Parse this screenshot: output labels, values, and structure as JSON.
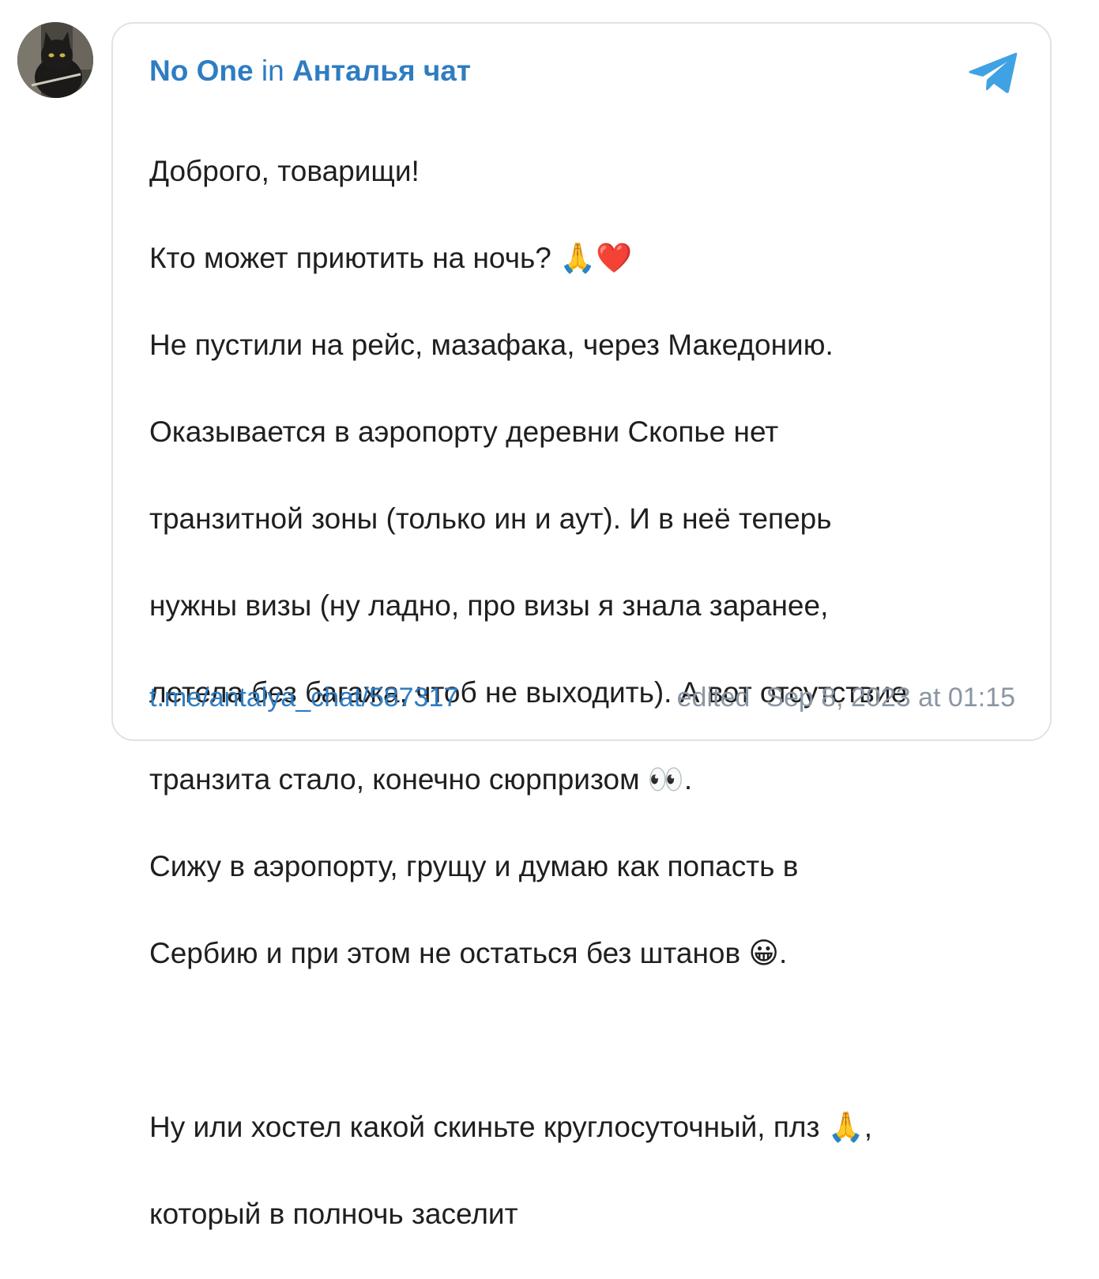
{
  "post": {
    "author": "No One",
    "connector": "in",
    "chat": "Анталья чат",
    "message_lines": [
      "Доброго, товарищи!",
      "Кто может приютить на ночь? 🙏❤️",
      "Не пустили на рейс, мазафака, через Македонию.",
      "Оказывается в аэропорту деревни Скопье нет",
      "транзитной зоны (только ин и аут). И в неё теперь",
      "нужны визы (ну ладно, про визы я знала заранее,",
      "летела без багажа, чтоб не выходить). А вот отсутствие",
      "транзита стало, конечно сюрпризом 👀.",
      "Сижу в аэропорту, грущу и думаю как попасть в",
      "Сербию и при этом не остаться без штанов 😀.",
      "",
      "Ну или хостел какой скиньте круглосуточный, плз 🙏,",
      "который в полночь заселит"
    ],
    "link": "t.me/antalya_chat/587317",
    "edited_label": "edited",
    "timestamp": "Sep 8, 2023 at 01:15"
  },
  "icons": {
    "avatar": "black-cat-avatar",
    "app_logo": "telegram-logo-icon"
  },
  "colors": {
    "accent": "#2f7dc1",
    "logo": "#3fa2e3",
    "muted": "#8b96a3",
    "border": "#dde3ea",
    "text": "#1f1f1f"
  }
}
